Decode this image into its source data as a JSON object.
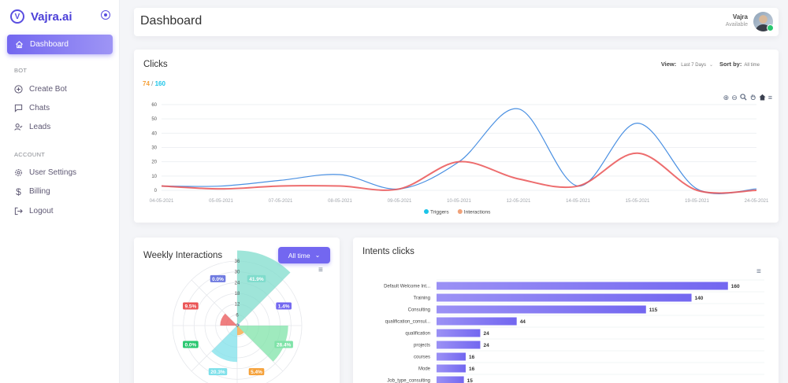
{
  "brand": {
    "name": "Vajra.ai",
    "logo_letter": "V",
    "logo_icon": "v-logo-icon",
    "toggle_icon": "radio-toggle-icon"
  },
  "sidebar": {
    "active": {
      "label": "Dashboard",
      "icon": "home-icon"
    },
    "section_bot": "BOT",
    "bot_items": [
      {
        "label": "Create Bot",
        "icon": "plus-circle-icon"
      },
      {
        "label": "Chats",
        "icon": "chat-icon"
      },
      {
        "label": "Leads",
        "icon": "user-check-icon"
      }
    ],
    "section_account": "ACCOUNT",
    "account_items": [
      {
        "label": "User Settings",
        "icon": "gear-icon"
      },
      {
        "label": "Billing",
        "icon": "dollar-icon"
      },
      {
        "label": "Logout",
        "icon": "logout-icon"
      }
    ]
  },
  "header": {
    "title": "Dashboard",
    "user_name": "Vajra",
    "user_status": "Available"
  },
  "clicks": {
    "title": "Clicks",
    "count_a": "74",
    "separator": "/",
    "count_b": "160",
    "view_label": "View:",
    "view_value": "Last 7 Days",
    "sort_label": "Sort by:",
    "sort_value": "All time",
    "tools": [
      "zoom-in-icon",
      "zoom-out-icon",
      "magnifier-icon",
      "pan-hand-icon",
      "reset-home-icon",
      "menu-icon"
    ]
  },
  "weekly": {
    "title": "Weekly Interactions",
    "button_label": "All time",
    "button_icon": "chevron-down-icon"
  },
  "intents": {
    "title": "Intents clicks"
  },
  "colors": {
    "accent": "#7367f0",
    "triggers": "#1bc4e8",
    "interactions": "#f0a27a",
    "interactions_line": "#ea5455"
  },
  "chart_data": [
    {
      "type": "line",
      "x": [
        "04-05-2021",
        "05-05-2021",
        "07-05-2021",
        "08-05-2021",
        "09-05-2021",
        "10-05-2021",
        "12-05-2021",
        "14-05-2021",
        "15-05-2021",
        "19-05-2021",
        "24-05-2021"
      ],
      "series": [
        {
          "name": "Triggers",
          "values": [
            3,
            3,
            7,
            11,
            1,
            20,
            57,
            3,
            47,
            1,
            1
          ]
        },
        {
          "name": "Interactions",
          "values": [
            3,
            1,
            3,
            3,
            1,
            20,
            8,
            3,
            26,
            0,
            0
          ]
        }
      ],
      "ylim": [
        0,
        60
      ],
      "yticks": [
        0,
        10,
        20,
        30,
        40,
        50,
        60
      ],
      "legend": "bottom",
      "grid": true
    },
    {
      "type": "polar-area",
      "categories": [
        "Default Welcome Intent",
        "Training",
        "Consulting",
        "qualification_consulting",
        "qualification",
        "projects",
        "courses",
        "Mode"
      ],
      "values": [
        41.9,
        1.4,
        28.4,
        5.4,
        20.3,
        0.0,
        9.5,
        0.0
      ],
      "labels": [
        "41.9%",
        "1.4%",
        "28.4%",
        "5.4%",
        "20.3%",
        "0.0%",
        "9.5%",
        "0.0%"
      ],
      "colors": [
        "#7fdccc",
        "#7367f0",
        "#7fe3a8",
        "#f5a13a",
        "#7ee0ea",
        "#28c76f",
        "#ea5455",
        "#6f7ae0"
      ],
      "rticks": [
        0,
        6,
        12,
        18,
        24,
        30,
        36
      ],
      "rlim": [
        0,
        36
      ]
    },
    {
      "type": "bar",
      "orientation": "horizontal",
      "categories": [
        "Default Welcome Int...",
        "Training",
        "Consulting",
        "qualification_consul...",
        "qualification",
        "projects",
        "courses",
        "Mode",
        "Job_type_consulting"
      ],
      "values": [
        160,
        140,
        115,
        44,
        24,
        24,
        16,
        16,
        15
      ],
      "xlim": [
        0,
        180
      ]
    }
  ]
}
